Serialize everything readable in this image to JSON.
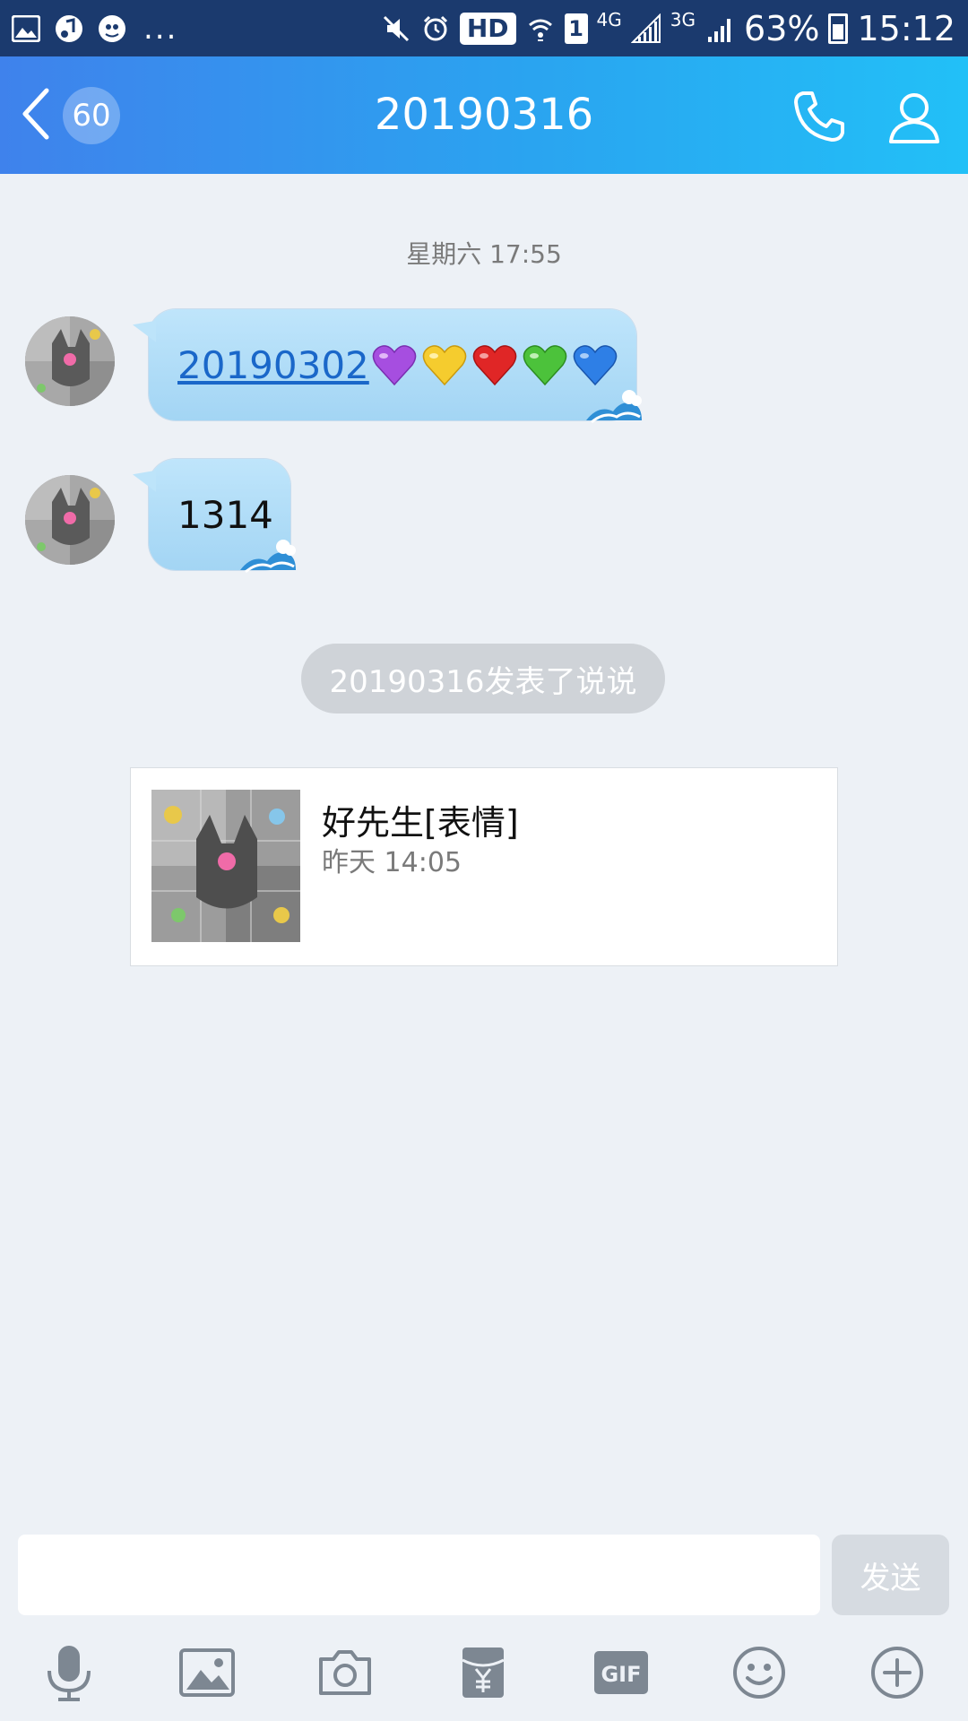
{
  "status_bar": {
    "more": "...",
    "hd": "HD",
    "sim": "1",
    "net1": "4G",
    "net2": "3G",
    "battery": "63%",
    "time": "15:12"
  },
  "header": {
    "unread_count": "60",
    "title": "20190316",
    "accent_start": "#3f82ec",
    "accent_end": "#22c0f7"
  },
  "messages": {
    "timestamp": "星期六 17:55",
    "items": [
      {
        "link": "20190302",
        "emojis": [
          "purple-heart",
          "yellow-heart",
          "red-heart",
          "green-heart",
          "blue-heart"
        ]
      },
      {
        "text": "1314"
      }
    ],
    "notice": "20190316发表了说说",
    "post": {
      "title": "好先生[表情]",
      "time": "昨天 14:05"
    }
  },
  "input": {
    "placeholder": "",
    "send_label": "发送"
  },
  "toolbar": {
    "gif_label": "GIF",
    "items": [
      "microphone-icon",
      "image-icon",
      "camera-icon",
      "red-packet-icon",
      "gif-icon",
      "emoji-icon",
      "plus-icon"
    ]
  }
}
